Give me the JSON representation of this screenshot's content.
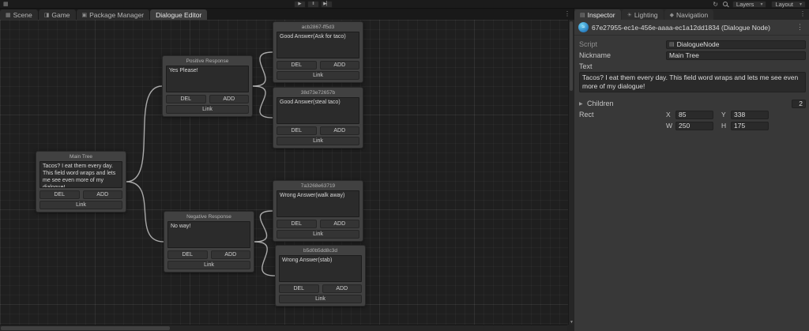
{
  "colors": {
    "connection": "#c2c2c2",
    "canvas_bg": "#1f1f1f",
    "panel_bg": "#383838",
    "node_icon_blue": "#2a7fc0"
  },
  "icons": {
    "app": "▦",
    "play": "▶",
    "pause": "‖",
    "step": "▶▏",
    "history": "↻",
    "dropdown_arrow": "▾",
    "menu_dots": "⋮",
    "scene": "▦",
    "game": "◨",
    "package": "▣",
    "inspector": "▤",
    "lighting": "☀",
    "navigation": "◆",
    "script": "▤",
    "foldout_collapsed": "▶",
    "scroll_down": "▼",
    "node_icon_glyph": "≈"
  },
  "toolbar": {
    "layers_label": "Layers",
    "layout_label": "Layout"
  },
  "editor_tabs": [
    {
      "label": "Scene"
    },
    {
      "label": "Game"
    },
    {
      "label": "Package Manager"
    },
    {
      "label": "Dialogue Editor"
    }
  ],
  "inspector_tabs": [
    {
      "label": "Inspector"
    },
    {
      "label": "Lighting"
    },
    {
      "label": "Navigation"
    }
  ],
  "inspector": {
    "title": "67e27955-ec1e-456e-aaaa-ec1a12dd1834 (Dialogue Node)",
    "script_label": "Script",
    "script_value": "DialogueNode",
    "nickname_label": "Nickname",
    "nickname_value": "Main Tree",
    "text_label": "Text",
    "text_value": "Tacos? I eat them every day. This field word wraps and lets me see even more of my dialogue!",
    "children_label": "Children",
    "children_value": "2",
    "rect_label": "Rect",
    "rect_x_label": "X",
    "rect_x": "85",
    "rect_y_label": "Y",
    "rect_y": "338",
    "rect_w_label": "W",
    "rect_w": "250",
    "rect_h_label": "H",
    "rect_h": "175"
  },
  "graph": {
    "button_labels": {
      "del": "DEL",
      "add": "ADD",
      "link": "Link"
    },
    "nodes": [
      {
        "id": "main-tree",
        "title": "Main Tree",
        "text": "Tacos? I eat them every day. This field word wraps and lets me see even more of my dialogue!"
      },
      {
        "id": "positive",
        "title": "Positive Response",
        "text": "Yes Please!"
      },
      {
        "id": "negative",
        "title": "Negative Response",
        "text": "No way!"
      },
      {
        "id": "good-ask",
        "title": "acb2867-ff5d3",
        "text": "Good Answer(Ask for taco)"
      },
      {
        "id": "good-steal",
        "title": "38d73e72657b",
        "text": "Good Answer(steal taco)"
      },
      {
        "id": "wrong-walk",
        "title": "7a3268e63719",
        "text": "Wrong Answer(walk away)"
      },
      {
        "id": "wrong-stab",
        "title": "b5d0b5dd8c3d",
        "text": "Wrong Answer(stab)"
      }
    ],
    "connections": [
      {
        "from": "main-tree",
        "to": "positive"
      },
      {
        "from": "main-tree",
        "to": "negative"
      },
      {
        "from": "positive",
        "to": "good-ask"
      },
      {
        "from": "positive",
        "to": "good-steal"
      },
      {
        "from": "negative",
        "to": "wrong-walk"
      },
      {
        "from": "negative",
        "to": "wrong-stab"
      }
    ]
  }
}
